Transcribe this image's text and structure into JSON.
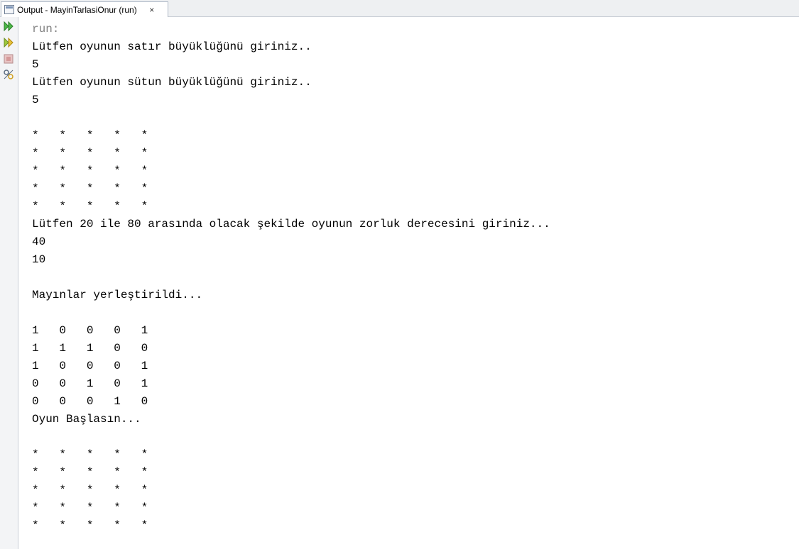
{
  "tab": {
    "title": "Output - MayinTarlasiOnur (run)",
    "icon": "output-window-icon",
    "close_label": "×"
  },
  "toolbar": {
    "buttons": [
      {
        "name": "rerun-icon",
        "color": "#3aa635"
      },
      {
        "name": "rerun-with-options-icon",
        "color": "#d0a020"
      },
      {
        "name": "stop-icon",
        "color": "#d9a0a0"
      },
      {
        "name": "settings-icon",
        "color": "#5b6c82"
      }
    ]
  },
  "console": {
    "lines": [
      "run:",
      "Lütfen oyunun satır büyüklüğünü giriniz..",
      "5",
      "Lütfen oyunun sütun büyüklüğünü giriniz..",
      "5",
      "",
      "*   *   *   *   *",
      "*   *   *   *   *",
      "*   *   *   *   *",
      "*   *   *   *   *",
      "*   *   *   *   *",
      "Lütfen 20 ile 80 arasında olacak şekilde oyunun zorluk derecesini giriniz...",
      "40",
      "10",
      "",
      "Mayınlar yerleştirildi...",
      "",
      "1   0   0   0   1",
      "1   1   1   0   0",
      "1   0   0   0   1",
      "0   0   1   0   1",
      "0   0   0   1   0",
      "Oyun Başlasın...",
      "",
      "*   *   *   *   *",
      "*   *   *   *   *",
      "*   *   *   *   *",
      "*   *   *   *   *",
      "*   *   *   *   *"
    ]
  }
}
